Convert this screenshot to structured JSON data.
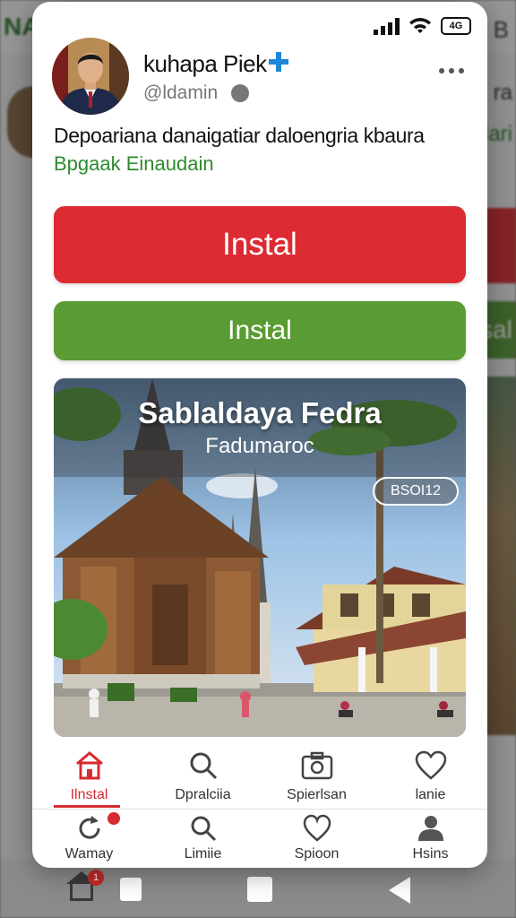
{
  "background": {
    "logo": "NA",
    "top_right_letter": "B",
    "side_text_1": "ra",
    "side_text_2": "lari",
    "side_button": "sal"
  },
  "status_bar": {
    "battery": "4G"
  },
  "profile": {
    "name": "kuhapa Piek",
    "handle": "@ldamin"
  },
  "post": {
    "description": "Depoariana danaigatiar daloengria kbaura",
    "sublink": "Bpgaak Einaudain"
  },
  "buttons": {
    "primary": "Instal",
    "secondary": "Instal"
  },
  "photo": {
    "title": "Sablaldaya Fedra",
    "subtitle": "Fadumaroc",
    "chip": "BSOI12"
  },
  "tabs_top": [
    {
      "label": "Ilnstal",
      "icon": "home-icon",
      "active": true
    },
    {
      "label": "Dpralciia",
      "icon": "search-icon",
      "active": false
    },
    {
      "label": "Spierlsan",
      "icon": "camera-icon",
      "active": false
    },
    {
      "label": "lanie",
      "icon": "heart-icon",
      "active": false
    }
  ],
  "tabs_bottom": [
    {
      "label": "Wamay",
      "icon": "refresh-icon"
    },
    {
      "label": "Limiie",
      "icon": "search-icon"
    },
    {
      "label": "Spioon",
      "icon": "heart-icon"
    },
    {
      "label": "Hsins",
      "icon": "person-icon"
    }
  ],
  "system_nav": {
    "badge": "1"
  },
  "colors": {
    "red": "#dc2b32",
    "green": "#5a9b34",
    "link_green": "#2e8b2e"
  }
}
